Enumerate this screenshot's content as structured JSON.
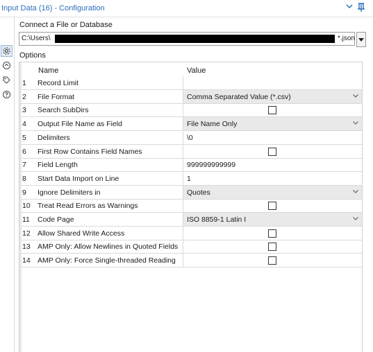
{
  "window": {
    "title": "Input Data (16) - Configuration"
  },
  "connect": {
    "label": "Connect a File or Database",
    "path_prefix": "C:\\Users\\",
    "path_suffix": "*.json"
  },
  "options_label": "Options",
  "grid": {
    "header_name": "Name",
    "header_value": "Value",
    "rows": [
      {
        "num": "1",
        "name": "Record Limit",
        "value": "",
        "type": "text"
      },
      {
        "num": "2",
        "name": "File Format",
        "value": "Comma Separated Value (*.csv)",
        "type": "dropdown"
      },
      {
        "num": "3",
        "name": "Search SubDirs",
        "value": "",
        "type": "checkbox"
      },
      {
        "num": "4",
        "name": "Output File Name as Field",
        "value": "File Name Only",
        "type": "dropdown"
      },
      {
        "num": "5",
        "name": "Delimiters",
        "value": "\\0",
        "type": "text"
      },
      {
        "num": "6",
        "name": "First Row Contains Field Names",
        "value": "",
        "type": "checkbox"
      },
      {
        "num": "7",
        "name": "Field Length",
        "value": "999999999999",
        "type": "text"
      },
      {
        "num": "8",
        "name": "Start Data Import on Line",
        "value": "1",
        "type": "text"
      },
      {
        "num": "9",
        "name": "Ignore Delimiters in",
        "value": "Quotes",
        "type": "dropdown"
      },
      {
        "num": "10",
        "name": "Treat Read Errors as Warnings",
        "value": "",
        "type": "checkbox"
      },
      {
        "num": "11",
        "name": "Code Page",
        "value": "ISO 8859-1 Latin I",
        "type": "dropdown"
      },
      {
        "num": "12",
        "name": "Allow Shared Write Access",
        "value": "",
        "type": "checkbox"
      },
      {
        "num": "13",
        "name": "AMP Only: Allow Newlines in Quoted Fields",
        "value": "",
        "type": "checkbox"
      },
      {
        "num": "14",
        "name": "AMP Only: Force Single-threaded Reading",
        "value": "",
        "type": "checkbox"
      }
    ]
  },
  "icons": [
    "gear-icon",
    "arrows-icon",
    "tag-icon",
    "help-icon",
    "chevron-down-icon",
    "pin-icon"
  ],
  "colors": {
    "title": "#2a6ebb",
    "dropdown_bg": "#e9e9e9",
    "selected_tab": "#dfe9f5"
  }
}
